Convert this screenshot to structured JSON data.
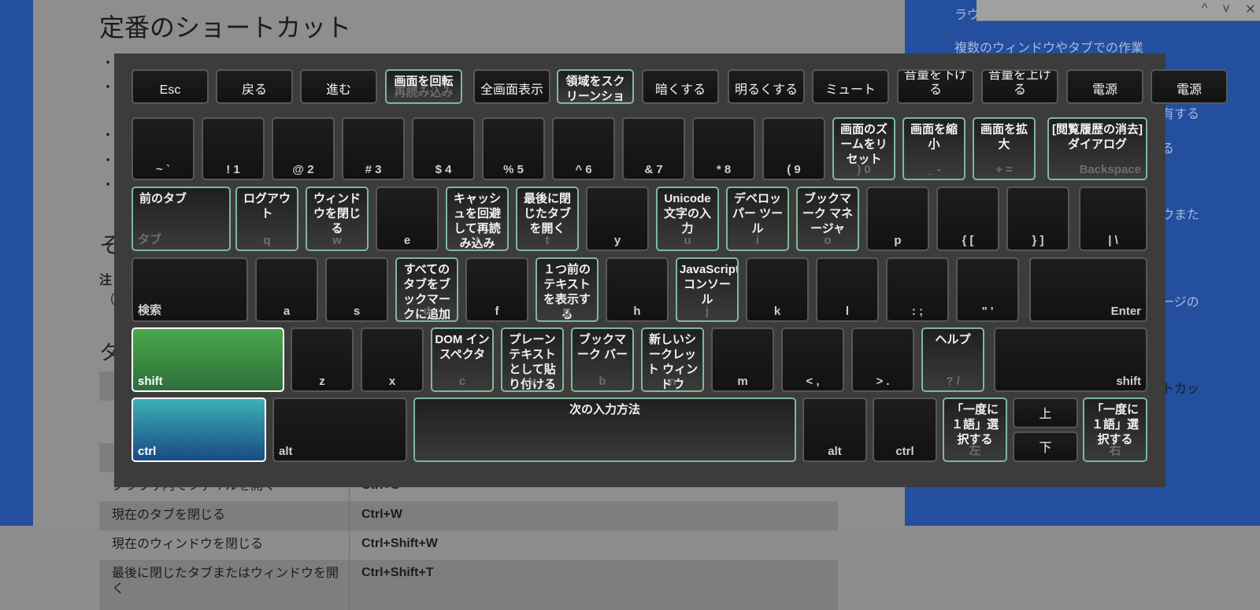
{
  "page": {
    "heading": "定番のショートカット",
    "fragments": {
      "sec2": "そ",
      "note": "注",
      "paren": "（",
      "tbl": "タ"
    },
    "bullets": [
      "・",
      "・",
      "・",
      "・",
      "・"
    ],
    "table": [
      {
        "desc": "ブラウザ内でファイルを開く",
        "keys": "Ctrl+O"
      },
      {
        "desc": "現在のタブを閉じる",
        "keys": "Ctrl+W"
      },
      {
        "desc": "現在のウィンドウを閉じる",
        "keys": "Ctrl+Shift+W"
      },
      {
        "desc": "最後に閉じたタブまたはウィンドウを開く",
        "keys": "Ctrl+Shift+T"
      }
    ]
  },
  "sidebar": {
    "links": [
      "ラウ",
      "複数のウィンドウやタブでの作業",
      "有する",
      "る",
      "ウまた",
      "ージの",
      "トカッ"
    ]
  },
  "findbar": {
    "up": "^",
    "down": "v",
    "close": "✕"
  },
  "keyboard": {
    "row1": [
      "Esc",
      "戻る",
      "進む",
      "画面を回転",
      "再読み込み",
      "全画面表示",
      "領域をスクリーンショット",
      "暗くする",
      "明るくする",
      "ミュート",
      "音量を下げる",
      "音量を上げる",
      "電源"
    ],
    "row2": [
      {
        "sub": "~ `"
      },
      {
        "sub": "! 1"
      },
      {
        "sub": "@ 2"
      },
      {
        "sub": "# 3"
      },
      {
        "sub": "$ 4"
      },
      {
        "sub": "% 5"
      },
      {
        "sub": "^ 6"
      },
      {
        "sub": "& 7"
      },
      {
        "sub": "* 8"
      },
      {
        "sub": "( 9"
      },
      {
        "lbl": "画面のズームをリセット",
        "sub": ") 0"
      },
      {
        "lbl": "画面を縮小",
        "sub": "_ -"
      },
      {
        "lbl": "画面を拡大",
        "sub": "+ ="
      },
      {
        "lbl": "[閲覧履歴の消去] ダイアログ",
        "sub": "Backspace"
      }
    ],
    "row3": [
      {
        "lbl": "前のタブ",
        "sub": "タブ"
      },
      {
        "lbl": "ログアウト",
        "sub": "q"
      },
      {
        "lbl": "ウィンドウを閉じる",
        "sub": "w"
      },
      {
        "sub": "e"
      },
      {
        "lbl": "キャッシュを回避して再読み込み",
        "sub": "r"
      },
      {
        "lbl": "最後に閉じたタブを開く",
        "sub": "t"
      },
      {
        "sub": "y"
      },
      {
        "lbl": "Unicode 文字の入力",
        "sub": "u"
      },
      {
        "lbl": "デベロッパー ツール",
        "sub": "i"
      },
      {
        "lbl": "ブックマーク マネージャ",
        "sub": "o"
      },
      {
        "sub": "p"
      },
      {
        "sub": "{ ["
      },
      {
        "sub": "} ]"
      },
      {
        "sub": "| \\"
      }
    ],
    "row4": [
      {
        "sub": "検索"
      },
      {
        "sub": "a"
      },
      {
        "sub": "s"
      },
      {
        "lbl": "すべてのタブをブックマークに追加する",
        "sub": "d"
      },
      {
        "sub": "f"
      },
      {
        "lbl": "１つ前のテキストを表示する",
        "sub": "g"
      },
      {
        "sub": "h"
      },
      {
        "lbl": "JavaScript コンソール",
        "sub": "j"
      },
      {
        "sub": "k"
      },
      {
        "sub": "l"
      },
      {
        "sub": ": ;"
      },
      {
        "sub": "\" '"
      },
      {
        "sub": "Enter"
      }
    ],
    "row5": [
      {
        "sub": "shift"
      },
      {
        "sub": "z"
      },
      {
        "sub": "x"
      },
      {
        "lbl": "DOM インスペクタ",
        "sub": "c"
      },
      {
        "lbl": "プレーンテキストとして貼り付ける",
        "sub": "v"
      },
      {
        "lbl": "ブックマーク バー",
        "sub": "b"
      },
      {
        "lbl": "新しいシークレット ウィンドウ",
        "sub": "n"
      },
      {
        "sub": "m"
      },
      {
        "sub": "< ,"
      },
      {
        "sub": "> ."
      },
      {
        "lbl": "ヘルプ",
        "sub": "? /"
      },
      {
        "sub": "shift"
      }
    ],
    "row6": [
      {
        "sub": "ctrl"
      },
      {
        "sub": "alt"
      },
      {
        "lbl": "次の入力方法"
      },
      {
        "sub": "alt"
      },
      {
        "sub": "ctrl"
      },
      {
        "lbl": "「一度に１語」選択する",
        "sub": "左"
      },
      {
        "sub": "上"
      },
      {
        "sub": "下"
      },
      {
        "lbl": "「一度に１語」選択する",
        "sub": "右"
      }
    ]
  }
}
